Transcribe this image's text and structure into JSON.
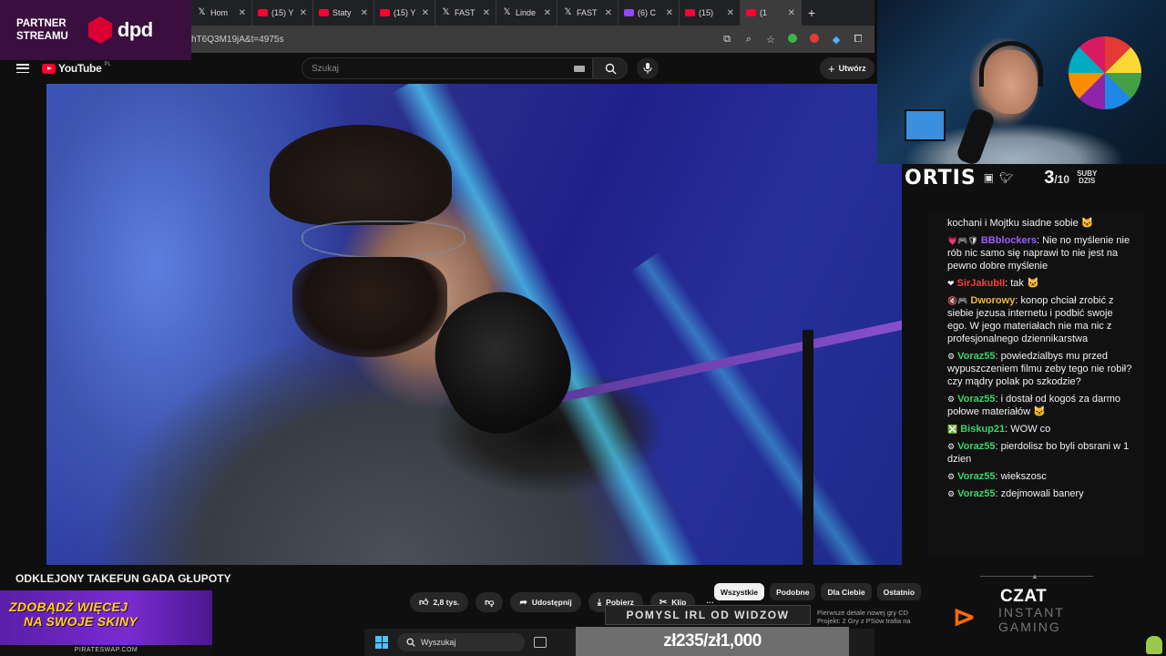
{
  "browser": {
    "tabs": [
      {
        "label": "Hom",
        "favicon": "x"
      },
      {
        "label": "(15) Y",
        "favicon": "yt"
      },
      {
        "label": "Staty",
        "favicon": "yt"
      },
      {
        "label": "(15) Y",
        "favicon": "yt"
      },
      {
        "label": "FAST",
        "favicon": "x"
      },
      {
        "label": "Linde",
        "favicon": "x"
      },
      {
        "label": "FAST",
        "favicon": "x"
      },
      {
        "label": "(6) C",
        "favicon": "tw"
      },
      {
        "label": "(15) ",
        "favicon": "yt"
      },
      {
        "label": "(1",
        "favicon": "yt",
        "active": true
      }
    ],
    "new_tab": "+",
    "url": "hT6Q3M19jA&t=4975s"
  },
  "youtube": {
    "logo_text": "YouTube",
    "logo_country": "PL",
    "search_placeholder": "Szukaj",
    "create_label": "Utwórz",
    "video_title": "ODKLEJONY TAKEFUN GADA GŁUPOTY",
    "actions": {
      "likes": "2,8 tys.",
      "share": "Udostępnij",
      "download": "Pobierz",
      "clip": "Klip",
      "more": "···"
    },
    "chips": [
      "Wszystkie",
      "Podobne",
      "Dla Ciebie",
      "Ostatnio"
    ]
  },
  "taskbar": {
    "search": "Wyszukaj"
  },
  "overlay": {
    "partner_line1": "PARTNER",
    "partner_line2": "STREAMU",
    "partner_brand": "dpd",
    "promo_line1": "ZDOBĄDŹ WIĘCEJ",
    "promo_line2": "NA SWOJE SKINY",
    "promo_site": "PIRATESWAP.COM",
    "streamer_name": "ORTIS",
    "subs_count": "3",
    "subs_goal": "/10",
    "subs_label1": "SUBY",
    "subs_label2": "DZIS",
    "banner": "POMYSL IRL OD WIDZOW",
    "ticker": "Pierwsze detale nowej gry CD Projekt: 2 Gry z PSów trafia na",
    "donation_goal": "zł235/zł1,000",
    "chat_logo_line1": "CZAT",
    "chat_logo_line2": "INSTANT",
    "chat_logo_line3": "GAMING"
  },
  "chat": [
    {
      "user": "",
      "color": "#ffffff",
      "badges": "",
      "text": "kochani i Mojtku siadne sobie 🐱"
    },
    {
      "user": "BBblockers",
      "color": "#9b5cff",
      "badges": "💗🎮🛡",
      "text": "Nie no myślenie nie rób nic samo się naprawi to nie jest na pewno dobre myślenie"
    },
    {
      "user": "SirJakubII",
      "color": "#ff3b3b",
      "badges": "❤",
      "text": "tak 🐱"
    },
    {
      "user": "Dworowy",
      "color": "#f2b632",
      "badges": "🔇🎮",
      "text": "konop chciał zrobić z siebie jezusa internetu i podbić swoje ego. W jego materiałach nie ma nic z profesjonalnego dziennikarstwa"
    },
    {
      "user": "Voraz55",
      "color": "#3bd46b",
      "badges": "⚙",
      "text": "powiedzialbys mu przed wypuszczeniem filmu zeby tego nie robił? czy mądry polak po szkodzie?"
    },
    {
      "user": "Voraz55",
      "color": "#3bd46b",
      "badges": "⚙",
      "text": "i dostał od kogoś za darmo połowe materiałów 🐱"
    },
    {
      "user": "Biskup21",
      "color": "#3bd46b",
      "badges": "❎",
      "text": "WOW co"
    },
    {
      "user": "Voraz55",
      "color": "#3bd46b",
      "badges": "⚙",
      "text": "pierdolisz bo byli obsrani w 1 dzien"
    },
    {
      "user": "Voraz55",
      "color": "#3bd46b",
      "badges": "⚙",
      "text": "wiekszosc"
    },
    {
      "user": "Voraz55",
      "color": "#3bd46b",
      "badges": "⚙",
      "text": "zdejmowali banery"
    }
  ]
}
